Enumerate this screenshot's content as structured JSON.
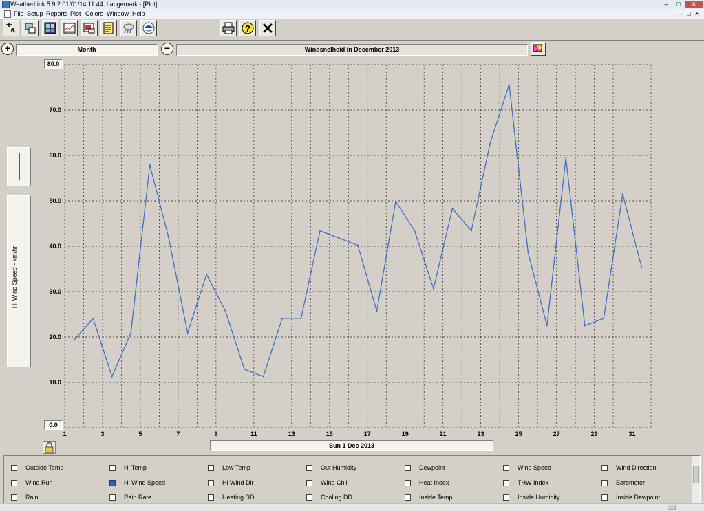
{
  "window": {
    "title": "WeatherLink 5.9.2  01/01/14  11:44: Langemark - [Plot]",
    "controls": [
      "–",
      "□",
      "✕"
    ]
  },
  "menu": {
    "items": [
      "File",
      "Setup",
      "Reports",
      "Plot",
      "Colors",
      "Window",
      "Help"
    ],
    "mdi_controls": [
      "–",
      "□",
      "✕"
    ]
  },
  "toolbar": {
    "icons": [
      "select-station-icon",
      "bulletin-icon",
      "summary-icon",
      "strip-chart-icon",
      "plot-icon",
      "notes-icon",
      "weather-icon",
      "noaa-icon"
    ],
    "print_icon": "printer-icon",
    "help_icon": "help-icon",
    "close_icon": "close-icon"
  },
  "plot_controls": {
    "zoom_in_symbol": "+",
    "zoom_out_symbol": "−",
    "period": "Month",
    "plot_title": "Windsnelheid in December 2013"
  },
  "y_axis": {
    "label": "Hi Wind Speed - km/hr",
    "top_value": "80.0",
    "bottom_value": "0.0"
  },
  "x_axis": {
    "date_label": "Sun 1 Dec 2013"
  },
  "colors": {
    "line": "#3f6fc6",
    "plot_bg": "#d4d0c8",
    "grid": "#222222",
    "checked": "#2f5fb3"
  },
  "chart_data": {
    "type": "line",
    "title": "Windsnelheid in December 2013",
    "xlabel": "Sun 1 Dec 2013",
    "ylabel": "Hi Wind Speed - km/hr",
    "xlim": [
      1,
      32
    ],
    "ylim": [
      0,
      80
    ],
    "x_ticks": [
      1,
      3,
      5,
      7,
      9,
      11,
      13,
      15,
      17,
      19,
      21,
      23,
      25,
      27,
      29,
      31
    ],
    "y_ticks": [
      "10.0",
      "20.0",
      "30.0",
      "40.0",
      "50.0",
      "60.0",
      "70.0"
    ],
    "grid": true,
    "series": [
      {
        "x": [
          1.5,
          2.5,
          3.5,
          4.5,
          5.5,
          6.5,
          7.5,
          8.5,
          9.5,
          10.5,
          11.5,
          12.5,
          13.5,
          14.5,
          15.5,
          16.5,
          17.5,
          18.5,
          19.5,
          20.5,
          21.5,
          22.5,
          23.5,
          24.5,
          25.5,
          26.5,
          27.5,
          28.5,
          29.5,
          30.5,
          31.5
        ],
        "values": [
          19.3,
          24.1,
          11.3,
          20.9,
          57.9,
          41.8,
          20.9,
          33.8,
          25.7,
          12.9,
          11.3,
          24.1,
          24.1,
          43.4,
          41.8,
          40.2,
          25.7,
          49.9,
          43.4,
          30.6,
          48.3,
          43.4,
          62.8,
          75.6,
          38.6,
          22.5,
          59.5,
          22.5,
          24.1,
          51.5,
          35.4
        ]
      }
    ]
  },
  "checkboxes": [
    [
      {
        "label": "Outside Temp",
        "checked": false
      },
      {
        "label": "Wind Run",
        "checked": false
      },
      {
        "label": "Rain",
        "checked": false
      }
    ],
    [
      {
        "label": "Hi Temp",
        "checked": false
      },
      {
        "label": "Hi Wind Speed",
        "checked": true
      },
      {
        "label": "Rain Rate",
        "checked": false
      }
    ],
    [
      {
        "label": "Low Temp",
        "checked": false
      },
      {
        "label": "Hi Wind Dir",
        "checked": false
      },
      {
        "label": "Heating DD",
        "checked": false
      }
    ],
    [
      {
        "label": "Out Humidity",
        "checked": false
      },
      {
        "label": "Wind Chill",
        "checked": false
      },
      {
        "label": "Cooling DD",
        "checked": false
      }
    ],
    [
      {
        "label": "Dewpoint",
        "checked": false
      },
      {
        "label": "Heat Index",
        "checked": false
      },
      {
        "label": "Inside Temp",
        "checked": false
      }
    ],
    [
      {
        "label": "Wind Speed",
        "checked": false
      },
      {
        "label": "THW Index",
        "checked": false
      },
      {
        "label": "Inside Humidity",
        "checked": false
      }
    ],
    [
      {
        "label": "Wind Direction",
        "checked": false
      },
      {
        "label": "Barometer",
        "checked": false
      },
      {
        "label": "Inside Dewpoint",
        "checked": false
      }
    ]
  ]
}
